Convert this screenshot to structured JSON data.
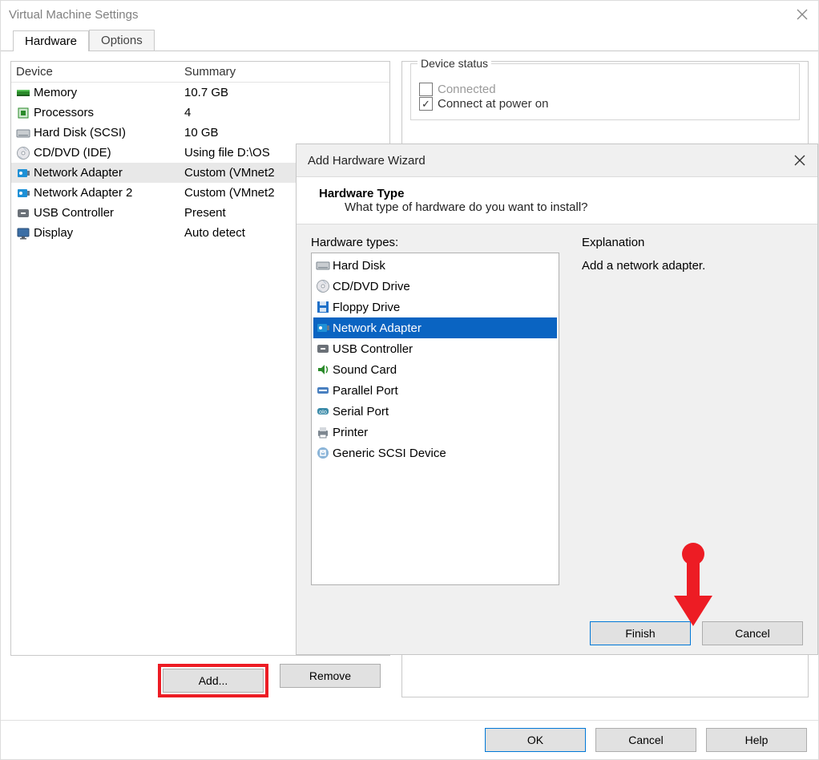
{
  "window": {
    "title": "Virtual Machine Settings",
    "tabs": [
      "Hardware",
      "Options"
    ],
    "active_tab": 0,
    "device_header": {
      "device": "Device",
      "summary": "Summary"
    },
    "devices": [
      {
        "icon": "memory",
        "name": "Memory",
        "summary": "10.7 GB",
        "selected": false
      },
      {
        "icon": "cpu",
        "name": "Processors",
        "summary": "4",
        "selected": false
      },
      {
        "icon": "disk",
        "name": "Hard Disk (SCSI)",
        "summary": "10 GB",
        "selected": false
      },
      {
        "icon": "cd",
        "name": "CD/DVD (IDE)",
        "summary": "Using file D:\\OS",
        "selected": false
      },
      {
        "icon": "net",
        "name": "Network Adapter",
        "summary": "Custom (VMnet2",
        "selected": true
      },
      {
        "icon": "net",
        "name": "Network Adapter 2",
        "summary": "Custom (VMnet2",
        "selected": false
      },
      {
        "icon": "usb",
        "name": "USB Controller",
        "summary": "Present",
        "selected": false
      },
      {
        "icon": "display",
        "name": "Display",
        "summary": "Auto detect",
        "selected": false
      }
    ],
    "buttons": {
      "add": "Add...",
      "remove": "Remove",
      "ok": "OK",
      "cancel": "Cancel",
      "help": "Help"
    },
    "device_status": {
      "group_title": "Device status",
      "connected": {
        "label": "Connected",
        "checked": false,
        "disabled": true
      },
      "connect_at_power_on": {
        "label": "Connect at power on",
        "checked": true,
        "disabled": false
      }
    }
  },
  "wizard": {
    "title": "Add Hardware Wizard",
    "heading": "Hardware Type",
    "subheading": "What type of hardware do you want to install?",
    "list_label": "Hardware types:",
    "explanation_label": "Explanation",
    "explanation_text": "Add a network adapter.",
    "items": [
      {
        "icon": "disk",
        "name": "Hard Disk",
        "selected": false
      },
      {
        "icon": "cd",
        "name": "CD/DVD Drive",
        "selected": false
      },
      {
        "icon": "floppy",
        "name": "Floppy Drive",
        "selected": false
      },
      {
        "icon": "net",
        "name": "Network Adapter",
        "selected": true
      },
      {
        "icon": "usb",
        "name": "USB Controller",
        "selected": false
      },
      {
        "icon": "sound",
        "name": "Sound Card",
        "selected": false
      },
      {
        "icon": "parallel",
        "name": "Parallel Port",
        "selected": false
      },
      {
        "icon": "serial",
        "name": "Serial Port",
        "selected": false
      },
      {
        "icon": "printer",
        "name": "Printer",
        "selected": false
      },
      {
        "icon": "scsi",
        "name": "Generic SCSI Device",
        "selected": false
      }
    ],
    "buttons": {
      "finish": "Finish",
      "cancel": "Cancel"
    }
  }
}
